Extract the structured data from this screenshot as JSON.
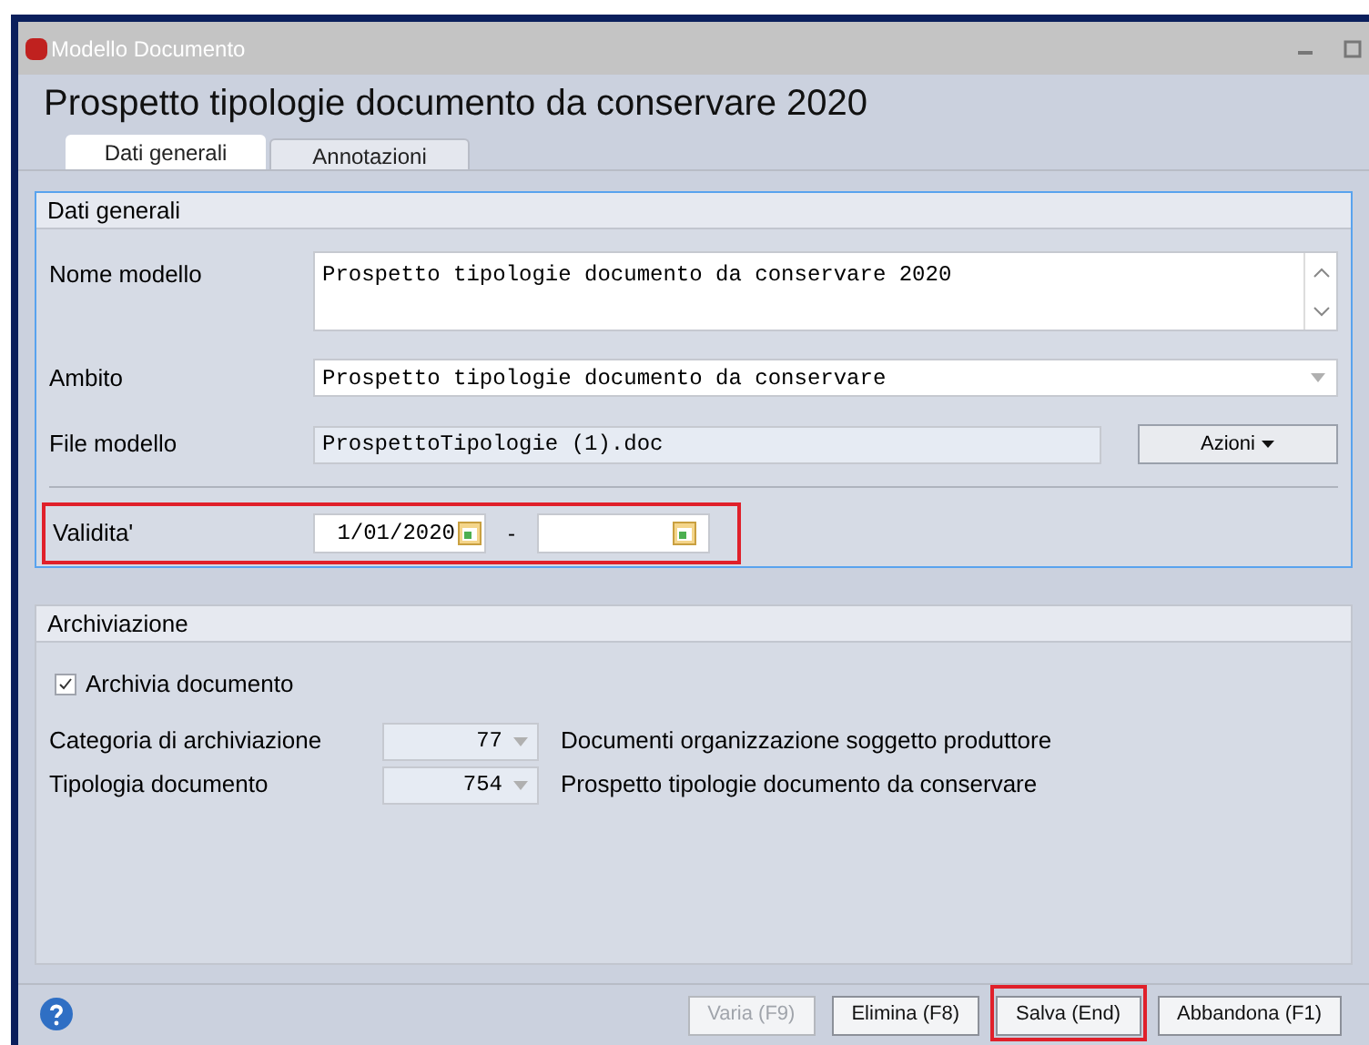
{
  "window": {
    "title": "Modello Documento"
  },
  "heading": "Prospetto tipologie documento da conservare 2020",
  "tabs": [
    {
      "label": "Dati generali",
      "selected": true
    },
    {
      "label": "Annotazioni",
      "selected": false
    }
  ],
  "general": {
    "title": "Dati generali",
    "name": {
      "label": "Nome modello",
      "value": "Prospetto tipologie documento da conservare 2020"
    },
    "scope": {
      "label": "Ambito",
      "value": "Prospetto tipologie documento da conservare"
    },
    "file": {
      "label": "File modello",
      "value": "ProspettoTipologie (1).doc",
      "action": "Azioni"
    },
    "validity": {
      "label": "Validita'",
      "from": "1/01/2020",
      "separator": "-",
      "highlighted": true
    }
  },
  "archive": {
    "title": "Archiviazione",
    "checkbox": {
      "label": "Archivia documento",
      "checked": true
    },
    "rows": [
      {
        "label": "Categoria di archiviazione",
        "code": "77",
        "description": "Documenti organizzazione soggetto produttore"
      },
      {
        "label": "Tipologia documento",
        "code": "754",
        "description": "Prospetto tipologie documento da conservare"
      }
    ]
  },
  "buttons": [
    {
      "label": "Varia (F9)",
      "disabled": true,
      "highlighted": false
    },
    {
      "label": "Elimina (F8)",
      "disabled": false,
      "highlighted": false
    },
    {
      "label": "Salva (End)",
      "disabled": false,
      "highlighted": true
    },
    {
      "label": "Abbandona (F1)",
      "disabled": false,
      "highlighted": false
    }
  ]
}
